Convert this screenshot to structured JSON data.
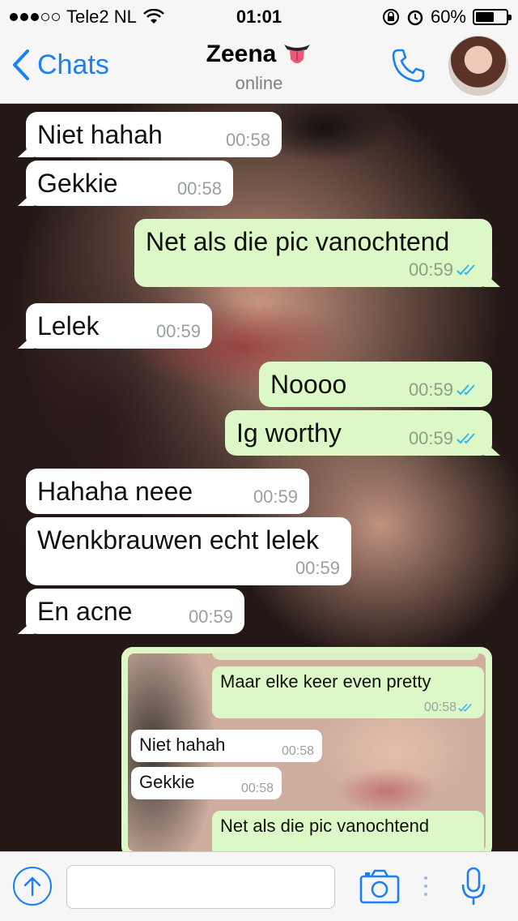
{
  "status_bar": {
    "carrier": "Tele2 NL",
    "time": "01:01",
    "battery": "60%",
    "battery_level": 0.6
  },
  "header": {
    "back_label": "Chats",
    "contact_name": "Zeena",
    "status": "online"
  },
  "messages": [
    {
      "id": "m1",
      "dir": "in",
      "text": "Niet hahah",
      "time": "00:58"
    },
    {
      "id": "m2",
      "dir": "in",
      "text": "Gekkie",
      "time": "00:58"
    },
    {
      "id": "m3",
      "dir": "out",
      "text": "Net als die pic vanochtend",
      "time": "00:59"
    },
    {
      "id": "m4",
      "dir": "in",
      "text": "Lelek",
      "time": "00:59"
    },
    {
      "id": "m5",
      "dir": "out",
      "text": "Noooo",
      "time": "00:59"
    },
    {
      "id": "m6",
      "dir": "out",
      "text": "Ig worthy",
      "time": "00:59"
    },
    {
      "id": "m7",
      "dir": "in",
      "text": "Hahaha neee",
      "time": "00:59"
    },
    {
      "id": "m8",
      "dir": "in",
      "text": "Wenkbrauwen echt lelek",
      "time": "00:59"
    },
    {
      "id": "m9",
      "dir": "in",
      "text": "En acne",
      "time": "00:59"
    }
  ],
  "screenshot_bubble": {
    "messages": [
      {
        "dir": "out",
        "text": "Maar elke keer even pretty",
        "time": "00:58"
      },
      {
        "dir": "in",
        "text": "Niet hahah",
        "time": "00:58"
      },
      {
        "dir": "in",
        "text": "Gekkie",
        "time": "00:58"
      },
      {
        "dir": "out",
        "text": "Net als die pic vanochtend",
        "time": ""
      }
    ]
  },
  "colors": {
    "accent": "#1b7ff5",
    "outgoing_bubble": "#dcf8c6",
    "incoming_bubble": "#ffffff",
    "read_ticks": "#34b7f1"
  }
}
